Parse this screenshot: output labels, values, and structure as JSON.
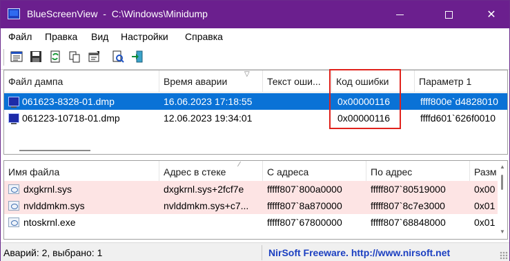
{
  "window": {
    "title": "BlueScreenView  -  C:\\Windows\\Minidump",
    "accent_color": "#6b1f8e",
    "close_glyph": "✕"
  },
  "menu": [
    "Файл",
    "Правка",
    "Вид",
    "Настройки",
    "Справка"
  ],
  "toolbar": {
    "icons": [
      "html-report-icon",
      "save-icon",
      "refresh-icon",
      "copy-icon",
      "properties-icon",
      "find-icon",
      "exit-icon"
    ]
  },
  "crash_list": {
    "columns": [
      "Файл дампа",
      "Время аварии",
      "Текст оши...",
      "Код ошибки",
      "Параметр 1"
    ],
    "sorted_column": "Время аварии",
    "rows": [
      {
        "file": "061623-8328-01.dmp",
        "time": "16.06.2023 17:18:55",
        "text": "",
        "code": "0x00000116",
        "param1": "ffff800e`d4828010",
        "selected": true
      },
      {
        "file": "061223-10718-01.dmp",
        "time": "12.06.2023 19:34:01",
        "text": "",
        "code": "0x00000116",
        "param1": "ffffd601`626f0010",
        "selected": false
      }
    ],
    "highlight_color": "#e0211b"
  },
  "module_list": {
    "columns": [
      "Имя файла",
      "Адрес в стеке",
      "С адреса",
      "По адрес",
      "Разм"
    ],
    "rows": [
      {
        "name": "dxgkrnl.sys",
        "stack": "dxgkrnl.sys+2fcf7e",
        "from": "fffff807`800a0000",
        "to": "fffff807`80519000",
        "size": "0x00",
        "highlighted": true
      },
      {
        "name": "nvlddmkm.sys",
        "stack": "nvlddmkm.sys+c7...",
        "from": "fffff807`8a870000",
        "to": "fffff807`8c7e3000",
        "size": "0x01",
        "highlighted": true
      },
      {
        "name": "ntoskrnl.exe",
        "stack": "",
        "from": "fffff807`67800000",
        "to": "fffff807`68848000",
        "size": "0x01",
        "highlighted": false
      }
    ]
  },
  "status": {
    "left": "Аварий: 2, выбрано: 1",
    "right": "NirSoft Freeware.  http://www.nirsoft.net"
  }
}
